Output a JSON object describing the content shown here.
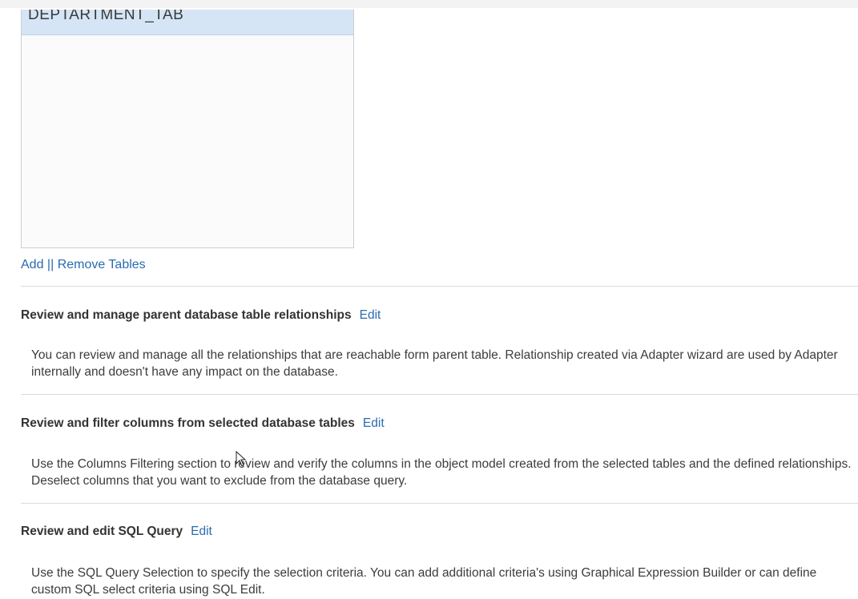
{
  "tables": {
    "items": [
      "DEPTARTMENT_TAB"
    ],
    "add_label": "Add",
    "separator": "||",
    "remove_label": "Remove Tables"
  },
  "sections": [
    {
      "title": "Review and manage parent database table relationships",
      "edit_label": "Edit",
      "description": "You can review and manage all the relationships that are reachable form parent table. Relationship created via Adapter wizard are used by Adapter internally and doesn't have any impact on the database."
    },
    {
      "title": "Review and filter columns from selected database tables",
      "edit_label": "Edit",
      "description": "Use the Columns Filtering section to review and verify the columns in the object model created from the selected tables and the defined relationships. Deselect columns that you want to exclude from the database query."
    },
    {
      "title": "Review and edit SQL Query",
      "edit_label": "Edit",
      "description": "Use the SQL Query Selection to specify the selection criteria. You can add additional criteria's using Graphical Expression Builder or can define custom SQL select criteria using SQL Edit."
    }
  ],
  "colors": {
    "link": "#2a6bb0",
    "selected_row": "#d6e5f5"
  }
}
